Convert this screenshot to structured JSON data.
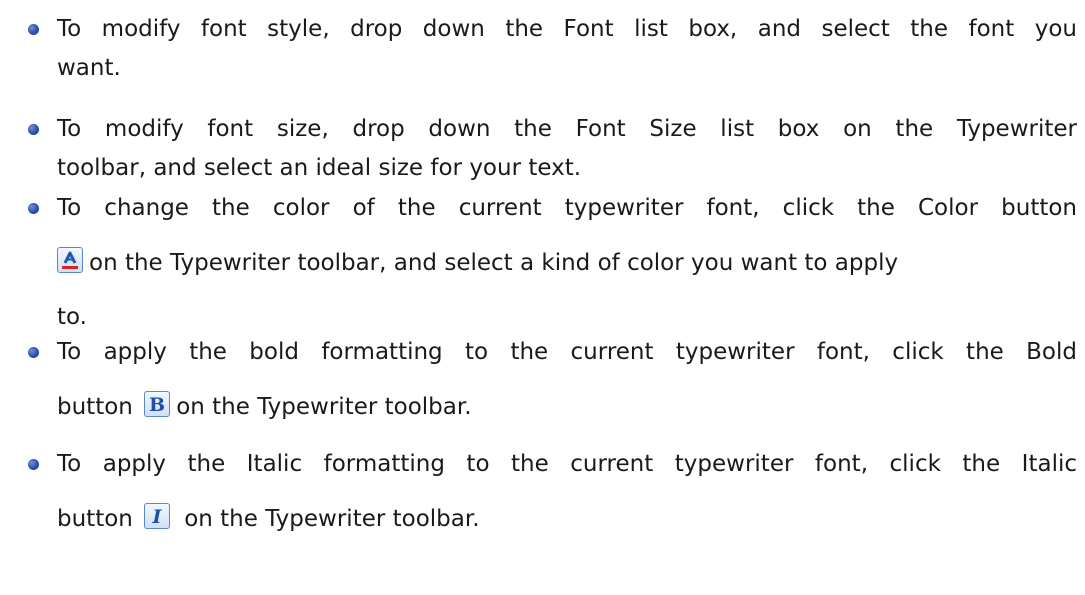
{
  "items": [
    {
      "lines": [
        "To modify font style, drop down the Font list box, and select the font you",
        "want."
      ]
    },
    {
      "lines": [
        "To modify font size, drop down the Font Size list box on the Typewriter",
        "toolbar, and select an ideal size for your text."
      ]
    },
    {
      "lines": [
        "To change the color of the current typewriter font, click the Color button",
        "on the Typewriter toolbar, and select a kind of color you want to apply",
        "to."
      ]
    },
    {
      "lines": [
        "To apply the bold formatting to the current typewriter font, click the Bold",
        "button",
        "on the Typewriter toolbar."
      ]
    },
    {
      "lines": [
        "To apply the Italic formatting to the current typewriter font, click the Italic",
        "button",
        "on the Typewriter toolbar."
      ]
    }
  ],
  "icons": {
    "color_button": "font-color-icon",
    "bold_button": "bold-icon",
    "italic_button": "italic-icon"
  },
  "colors": {
    "bullet": "#2a4fae",
    "icon_border": "#5b87c9",
    "text": "#1a1a1a"
  }
}
